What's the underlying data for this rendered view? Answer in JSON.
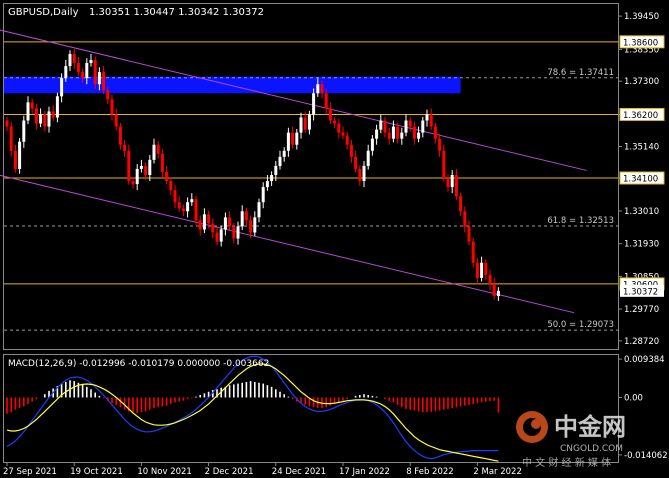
{
  "header": {
    "symbol": "GBPUSD,Daily",
    "ohlc": "1.30351 1.30447 1.30342 1.30372"
  },
  "indicator": {
    "label": "MACD(12,26,9) -0.012996 -0.010179 0.000000 -0.003662"
  },
  "colors": {
    "background": "#000000",
    "bull": "#ffffff",
    "bear": "#ff0000",
    "level_line": "#e6b800",
    "channel": "#b44ad4",
    "zone": "#0a14ff",
    "macd_line": "#1e3cff",
    "signal_line": "#ffff33",
    "grid_dashed": "#9a9a9a",
    "price_label_bg": "#ffffff"
  },
  "watermark": {
    "brand_cn": "中金网",
    "brand_en": "CNGOLD.COM",
    "tagline": "中 文 财 经 新 媒 体"
  },
  "chart_data": [
    {
      "type": "candlestick",
      "title": "GBPUSD,Daily",
      "ylim": [
        1.2845,
        1.3985
      ],
      "y_ticks": [
        "1.39450",
        "1.38350",
        "1.37300",
        "1.36200",
        "1.35140",
        "1.34100",
        "1.33010",
        "1.31930",
        "1.30850",
        "1.29770",
        "1.28720"
      ],
      "x_ticks": [
        "27 Sep 2021",
        "19 Oct 2021",
        "10 Nov 2021",
        "2 Dec 2021",
        "24 Dec 2021",
        "17 Jan 2022",
        "8 Feb 2022",
        "2 Mar 2022"
      ],
      "x_tick_index": [
        0,
        16,
        32,
        48,
        64,
        80,
        96,
        112
      ],
      "horizontal_levels": [
        {
          "value": 1.386,
          "label": "1.38600"
        },
        {
          "value": 1.362,
          "label": "1.36200"
        },
        {
          "value": 1.341,
          "label": "1.34100"
        },
        {
          "value": 1.306,
          "label": "1.30600"
        }
      ],
      "current_price": {
        "value": 1.30372,
        "label": "1.30372"
      },
      "fibonacci": [
        {
          "value": 1.37411,
          "label": "78.6 = 1.37411"
        },
        {
          "value": 1.32513,
          "label": "61.8 = 1.32513"
        },
        {
          "value": 1.29073,
          "label": "50.0 = 1.29073"
        }
      ],
      "zone": {
        "from": 1.369,
        "to": 1.3745,
        "start_index": 0,
        "end_index": 108
      },
      "channel": [
        {
          "from_index": -2,
          "from_value": 1.39,
          "to_index": 138,
          "to_value": 1.3435
        },
        {
          "from_index": -2,
          "from_value": 1.342,
          "to_index": 135,
          "to_value": 1.2965
        }
      ],
      "closes": [
        1.358,
        1.35,
        1.344,
        1.353,
        1.36,
        1.366,
        1.364,
        1.359,
        1.362,
        1.358,
        1.363,
        1.361,
        1.368,
        1.374,
        1.378,
        1.382,
        1.379,
        1.376,
        1.374,
        1.379,
        1.38,
        1.372,
        1.376,
        1.37,
        1.367,
        1.362,
        1.358,
        1.352,
        1.35,
        1.34,
        1.339,
        1.344,
        1.345,
        1.342,
        1.347,
        1.352,
        1.349,
        1.343,
        1.34,
        1.337,
        1.333,
        1.331,
        1.33,
        1.333,
        1.334,
        1.327,
        1.324,
        1.329,
        1.326,
        1.323,
        1.32,
        1.324,
        1.328,
        1.325,
        1.321,
        1.325,
        1.33,
        1.327,
        1.323,
        1.328,
        1.333,
        1.338,
        1.34,
        1.342,
        1.345,
        1.348,
        1.35,
        1.356,
        1.352,
        1.356,
        1.361,
        1.357,
        1.362,
        1.369,
        1.372,
        1.369,
        1.364,
        1.36,
        1.359,
        1.356,
        1.355,
        1.352,
        1.348,
        1.344,
        1.34,
        1.345,
        1.35,
        1.354,
        1.357,
        1.36,
        1.356,
        1.354,
        1.358,
        1.354,
        1.356,
        1.36,
        1.358,
        1.354,
        1.356,
        1.36,
        1.362,
        1.358,
        1.354,
        1.35,
        1.341,
        1.338,
        1.342,
        1.335,
        1.33,
        1.325,
        1.32,
        1.313,
        1.308,
        1.313,
        1.309,
        1.306,
        1.302,
        1.30372
      ],
      "macd": {
        "series": [
          {
            "name": "histogram",
            "values": [
              -0.004,
              -0.0036,
              -0.003,
              -0.0026,
              -0.0022,
              -0.0016,
              -0.001,
              -0.0004,
              0.0,
              0.0008,
              0.0016,
              0.0022,
              0.0028,
              0.0034,
              0.0038,
              0.0042,
              0.004,
              0.0036,
              0.0032,
              0.0026,
              0.002,
              0.0012,
              0.0004,
              -0.0002,
              -0.0008,
              -0.0014,
              -0.0018,
              -0.0024,
              -0.003,
              -0.0034,
              -0.0036,
              -0.0038,
              -0.0036,
              -0.0034,
              -0.003,
              -0.0026,
              -0.0024,
              -0.0022,
              -0.002,
              -0.0016,
              -0.0012,
              -0.001,
              -0.0008,
              -0.0004,
              -0.0002,
              0.0002,
              0.0006,
              0.001,
              0.0014,
              0.0018,
              0.002,
              0.0024,
              0.0026,
              0.003,
              0.0032,
              0.0034,
              0.0036,
              0.0038,
              0.004,
              0.0038,
              0.0036,
              0.0034,
              0.003,
              0.0026,
              0.002,
              0.0014,
              0.0008,
              0.0002,
              -0.0004,
              -0.001,
              -0.0014,
              -0.0018,
              -0.0022,
              -0.0024,
              -0.0026,
              -0.0026,
              -0.0024,
              -0.002,
              -0.0016,
              -0.0012,
              -0.0008,
              -0.0004,
              0.0,
              0.0004,
              0.0006,
              0.0008,
              0.0006,
              0.0004,
              0.0002,
              0.0,
              -0.0004,
              -0.0008,
              -0.0012,
              -0.0018,
              -0.0024,
              -0.0028,
              -0.003,
              -0.0032,
              -0.0034,
              -0.0036,
              -0.0036,
              -0.0035,
              -0.0034,
              -0.0032,
              -0.003,
              -0.0028,
              -0.0026,
              -0.0024,
              -0.0022,
              -0.002,
              -0.0018,
              -0.0016,
              -0.0014,
              -0.0012,
              -0.001,
              -0.0009,
              -0.0008,
              -0.0037
            ]
          },
          {
            "name": "macd",
            "values": [
              -0.012,
              -0.0114,
              -0.0106,
              -0.0096,
              -0.0084,
              -0.007,
              -0.0056,
              -0.0042,
              -0.0028,
              -0.0014,
              0.0,
              0.0012,
              0.0024,
              0.0034,
              0.0042,
              0.0048,
              0.005,
              0.005,
              0.0047,
              0.0042,
              0.0035,
              0.0026,
              0.0016,
              0.0005,
              -0.0006,
              -0.0018,
              -0.003,
              -0.0042,
              -0.0054,
              -0.0064,
              -0.0072,
              -0.0078,
              -0.0082,
              -0.0084,
              -0.0084,
              -0.0082,
              -0.0079,
              -0.0075,
              -0.0071,
              -0.0066,
              -0.0061,
              -0.0056,
              -0.005,
              -0.0044,
              -0.0037,
              -0.0029,
              -0.002,
              -0.001,
              0.0,
              0.0012,
              0.0024,
              0.0036,
              0.0048,
              0.006,
              0.0072,
              0.0082,
              0.009,
              0.0096,
              0.01,
              0.0101,
              0.0099,
              0.0094,
              0.0086,
              0.0076,
              0.0064,
              0.005,
              0.0036,
              0.0022,
              0.0008,
              -0.0004,
              -0.0014,
              -0.0022,
              -0.0028,
              -0.0032,
              -0.0034,
              -0.0034,
              -0.0032,
              -0.0029,
              -0.0025,
              -0.002,
              -0.0016,
              -0.0012,
              -0.0009,
              -0.0007,
              -0.0006,
              -0.0006,
              -0.0008,
              -0.0012,
              -0.0018,
              -0.0026,
              -0.0036,
              -0.0048,
              -0.0062,
              -0.0078,
              -0.0094,
              -0.0108,
              -0.012,
              -0.013,
              -0.0138,
              -0.0144,
              -0.0148,
              -0.015,
              -0.0148,
              -0.0144,
              -0.014,
              -0.0138,
              -0.0136,
              -0.0134,
              -0.0133,
              -0.0132,
              -0.0131,
              -0.013,
              -0.013,
              -0.013,
              -0.013,
              -0.013,
              -0.013,
              -0.013
            ]
          },
          {
            "name": "signal",
            "values": [
              -0.008,
              -0.0082,
              -0.0082,
              -0.008,
              -0.0076,
              -0.007,
              -0.0062,
              -0.0054,
              -0.0044,
              -0.0034,
              -0.0024,
              -0.0014,
              -0.0004,
              0.0006,
              0.0014,
              0.002,
              0.0026,
              0.003,
              0.0032,
              0.0033,
              0.0032,
              0.003,
              0.0026,
              0.0021,
              0.0015,
              0.0008,
              0.0,
              -0.0009,
              -0.0018,
              -0.0028,
              -0.0038,
              -0.0046,
              -0.0054,
              -0.006,
              -0.0064,
              -0.0067,
              -0.0068,
              -0.0068,
              -0.0067,
              -0.0065,
              -0.0062,
              -0.0058,
              -0.0054,
              -0.0049,
              -0.0044,
              -0.0038,
              -0.0032,
              -0.0024,
              -0.0016,
              -0.0006,
              0.0004,
              0.0014,
              0.0024,
              0.0034,
              0.0044,
              0.0054,
              0.0062,
              0.007,
              0.0076,
              0.008,
              0.0082,
              0.0082,
              0.008,
              0.0076,
              0.007,
              0.0062,
              0.0054,
              0.0044,
              0.0034,
              0.0024,
              0.0014,
              0.0006,
              -0.0002,
              -0.0008,
              -0.0012,
              -0.0014,
              -0.0015,
              -0.0015,
              -0.0014,
              -0.0012,
              -0.001,
              -0.0008,
              -0.0007,
              -0.0006,
              -0.0006,
              -0.0006,
              -0.0007,
              -0.0009,
              -0.0012,
              -0.0016,
              -0.0022,
              -0.003,
              -0.004,
              -0.0052,
              -0.0064,
              -0.0076,
              -0.0086,
              -0.0096,
              -0.0104,
              -0.011,
              -0.0116,
              -0.012,
              -0.0124,
              -0.0128,
              -0.013,
              -0.0132,
              -0.0134,
              -0.0136,
              -0.0138,
              -0.014,
              -0.0142,
              -0.0144,
              -0.0146,
              -0.0148,
              -0.015,
              -0.0152,
              -0.0154,
              -0.0156
            ]
          }
        ],
        "y_ticks": [
          "0.009384",
          "0.00",
          "-0.014062"
        ],
        "ylim": [
          -0.0158,
          0.0104
        ]
      }
    }
  ]
}
